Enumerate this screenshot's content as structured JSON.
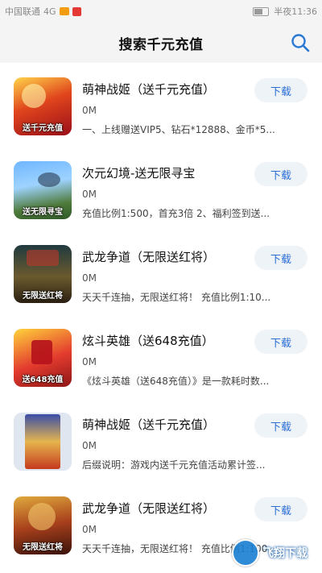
{
  "status_bar": {
    "carrier": "中国联通",
    "time": "半夜11:36",
    "signal_text": "4G"
  },
  "header": {
    "title": "搜索千元充值"
  },
  "download_label": "下载",
  "items": [
    {
      "name": "萌神战姬（送千元充值）",
      "size": "0M",
      "desc": "一、上线赠送VIP5、钻石*12888、金币*5...",
      "tag": "送千元充值"
    },
    {
      "name": "次元幻境-送无限寻宝",
      "size": "0M",
      "desc": "充值比例1:500，首充3倍 2、福利签到送...",
      "tag": "送无限寻宝"
    },
    {
      "name": "武龙争道（无限送红将）",
      "size": "0M",
      "desc": "天天千连抽，无限送红将！ 充值比例1:10...",
      "tag": "无限送红将"
    },
    {
      "name": "炫斗英雄（送648充值）",
      "size": "0M",
      "desc": "《炫斗英雄（送648充值）》是一款耗时数...",
      "tag": "送648充值"
    },
    {
      "name": "萌神战姬（送千元充值）",
      "size": "0M",
      "desc": "后缀说明：游戏内送千元充值活动累计签...",
      "tag": ""
    },
    {
      "name": "武龙争道（无限送红将）",
      "size": "0M",
      "desc": "天天千连抽，无限送红将！ 充值比例1:100",
      "tag": "无限送红将"
    }
  ],
  "watermark": {
    "text": "飞翔下载"
  }
}
